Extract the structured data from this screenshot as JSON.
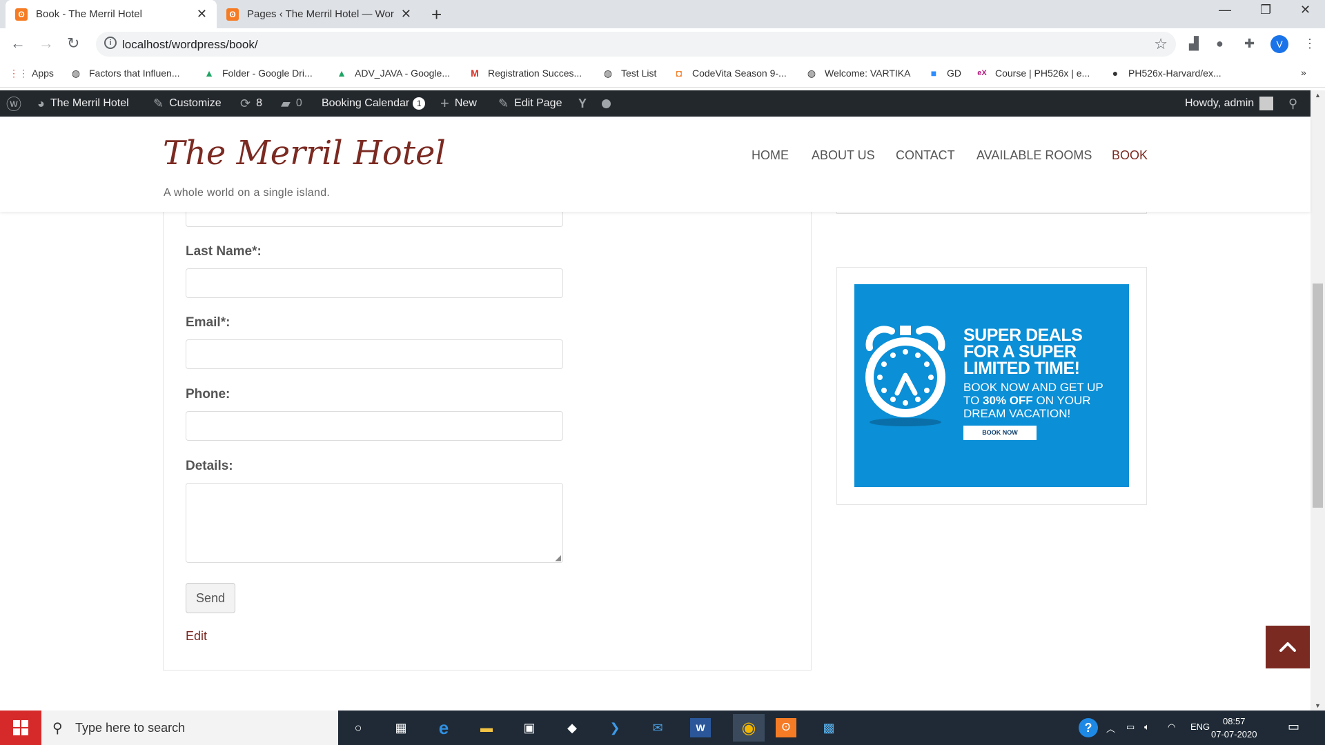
{
  "browser": {
    "tabs": [
      {
        "title": "Book - The Merril Hotel",
        "active": true
      },
      {
        "title": "Pages ‹ The Merril Hotel — Word",
        "active": false
      }
    ],
    "url": "localhost/wordpress/book/",
    "profile_initial": "V",
    "bookmarks": [
      {
        "label": "Apps",
        "icon": "apps-grid-icon"
      },
      {
        "label": "Factors that Influen...",
        "icon": "globe-icon"
      },
      {
        "label": "Folder - Google Dri...",
        "icon": "google-drive-icon"
      },
      {
        "label": "ADV_JAVA - Google...",
        "icon": "google-drive-icon"
      },
      {
        "label": "Registration Succes...",
        "icon": "gmail-icon"
      },
      {
        "label": "Test List",
        "icon": "globe-icon"
      },
      {
        "label": "CodeVita Season 9-...",
        "icon": "codevita-icon"
      },
      {
        "label": "Welcome: VARTIKA",
        "icon": "globe-icon"
      },
      {
        "label": "GD",
        "icon": "zoom-icon"
      },
      {
        "label": "Course | PH526x | e...",
        "icon": "edx-icon"
      },
      {
        "label": "PH526x-Harvard/ex...",
        "icon": "github-icon"
      }
    ]
  },
  "adminbar": {
    "site": "The Merril Hotel",
    "customize": "Customize",
    "updates": "8",
    "comments": "0",
    "booking_calendar": "Booking Calendar",
    "booking_badge": "1",
    "new": "New",
    "edit_page": "Edit Page",
    "howdy": "Howdy, admin"
  },
  "site": {
    "title": "The Merril Hotel",
    "tagline": "A whole world on a single island.",
    "nav": [
      "HOME",
      "ABOUT US",
      "CONTACT",
      "AVAILABLE ROOMS",
      "BOOK"
    ],
    "current_nav": "BOOK",
    "accent": "#7b2a22"
  },
  "form": {
    "last_name_label": "Last Name*:",
    "email_label": "Email*:",
    "phone_label": "Phone:",
    "details_label": "Details:",
    "send_label": "Send",
    "edit_label": "Edit"
  },
  "promo": {
    "headline_1": "SUPER DEALS",
    "headline_2": "FOR A SUPER",
    "headline_3": "LIMITED TIME!",
    "sub_1": "BOOK NOW AND GET UP",
    "sub_2_pre": "TO ",
    "sub_2_bold": "30% OFF",
    "sub_2_post": " ON YOUR",
    "sub_3": "DREAM VACATION!",
    "cta": "BOOK NOW",
    "bg_color": "#0b8fd6"
  },
  "taskbar": {
    "search_placeholder": "Type here to search",
    "language": "ENG",
    "time": "08:57",
    "date": "07-07-2020"
  }
}
